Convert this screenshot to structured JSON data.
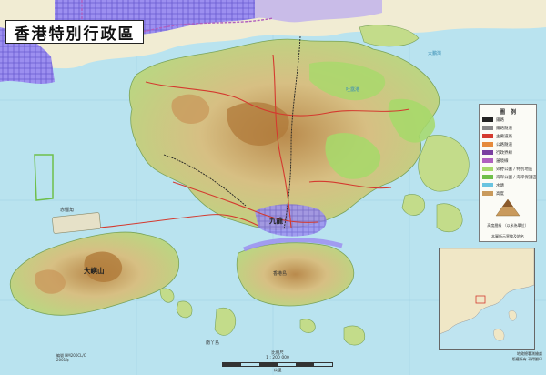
{
  "title": "香港特別行政區",
  "legend": {
    "title": "圖　例",
    "items": [
      {
        "label": "鐵路",
        "color": "#222222"
      },
      {
        "label": "鐵路隧道",
        "color": "#888888"
      },
      {
        "label": "主要道路",
        "color": "#d43a2f"
      },
      {
        "label": "公路隧道",
        "color": "#e68a3c"
      },
      {
        "label": "行政界線",
        "color": "#7a3fa0"
      },
      {
        "label": "邊境線",
        "color": "#b05fbf"
      },
      {
        "label": "郊野公園 / 特別地區",
        "color": "#a6d96a"
      },
      {
        "label": "海岸公園 / 海岸保護區",
        "color": "#6fbf4a"
      },
      {
        "label": "水塘",
        "color": "#6ac4e0"
      },
      {
        "label": "高度",
        "color": "#c99a5c"
      }
    ],
    "elevation_note": "高度層級 （以米為單位）",
    "bottom_note": "本圖所示界線及地名"
  },
  "places": {
    "kowloon": "九龍",
    "lantau": "大嶼山",
    "chek_lap_kok": "赤鱲角",
    "lamma": "南丫島",
    "mirs_bay": "大鵬灣",
    "hk_island": "香港島",
    "tolo": "吐露港"
  },
  "scale": {
    "label": "比例尺",
    "ratio": "1 : 200 000",
    "unit": "公里"
  },
  "reference": {
    "line1": "編號 HM200CL/C",
    "line2": "2001年"
  },
  "credits": {
    "line1": "地政總署測繪處",
    "line2": "版權所有 不得翻印"
  },
  "colors": {
    "sea": "#b9e3ef",
    "land": "#e9d9a4",
    "park": "#a6d96a",
    "urban": "#7b6fd6",
    "road": "#d43a2f"
  }
}
